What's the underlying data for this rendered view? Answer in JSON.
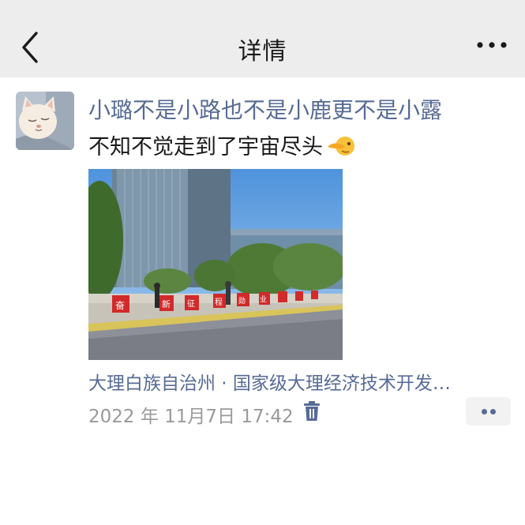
{
  "header": {
    "title": "详情",
    "back_icon": "chevron-left-icon",
    "more_icon": "more-dots-icon"
  },
  "post": {
    "nickname": "小璐不是小路也不是小鹿更不是小露",
    "text": "不知不觉走到了宇宙尽头",
    "emoji": "pointing-hand-emoji",
    "photo_banner_chars": [
      "奋",
      "新",
      "征",
      "程",
      "勋",
      "业"
    ],
    "location": "大理白族自治州 · 国家级大理经济技术开发…",
    "timestamp": "2022 年 11月7日 17:42",
    "delete_icon": "trash-icon",
    "action_icon": "comment-like-dots-icon"
  },
  "colors": {
    "link": "#576b95",
    "header_bg": "#ededed",
    "muted": "#9a9a9a"
  }
}
